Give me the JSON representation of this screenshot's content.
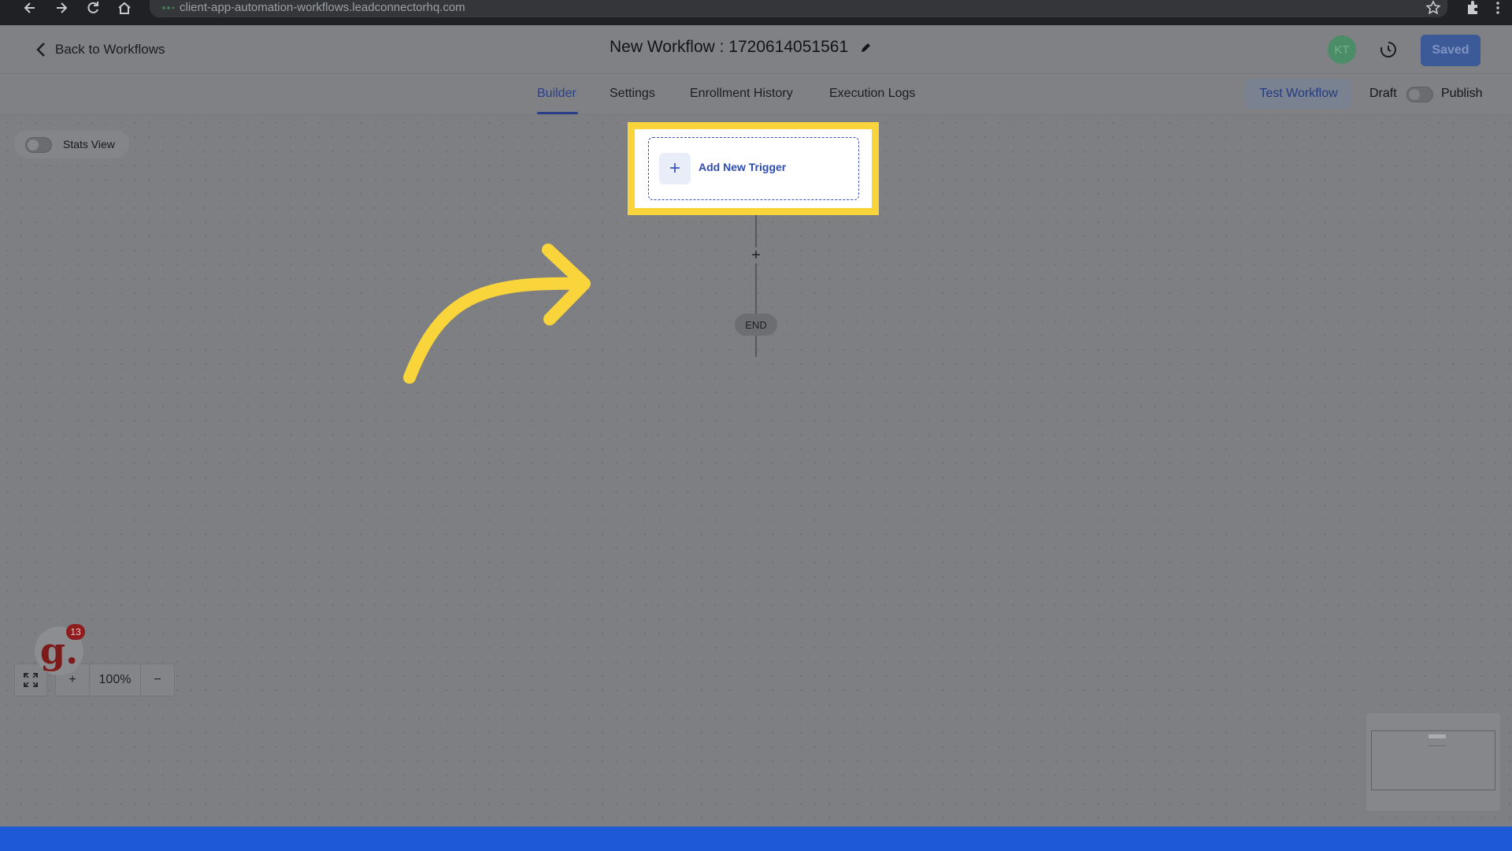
{
  "browser": {
    "url": "client-app-automation-workflows.leadconnectorhq.com"
  },
  "header": {
    "back_label": "Back to Workflows",
    "workflow_title": "New Workflow : 1720614051561",
    "avatar_initials": "KT",
    "saved_label": "Saved"
  },
  "tabs": {
    "items": [
      {
        "label": "Builder",
        "active": true
      },
      {
        "label": "Settings",
        "active": false
      },
      {
        "label": "Enrollment History",
        "active": false
      },
      {
        "label": "Execution Logs",
        "active": false
      }
    ],
    "test_workflow_label": "Test Workflow",
    "draft_label": "Draft",
    "publish_label": "Publish"
  },
  "canvas": {
    "stats_view_label": "Stats View",
    "trigger_label": "Add New Trigger",
    "add_step_symbol": "+",
    "end_label": "END"
  },
  "zoom": {
    "level": "100%",
    "in_symbol": "+",
    "out_symbol": "−"
  },
  "widget": {
    "logo_letter": "g.",
    "badge_count": "13"
  },
  "colors": {
    "highlight": "#f9d43a",
    "accent": "#2d4cb3",
    "bottom_bar": "#1d5ad8"
  }
}
